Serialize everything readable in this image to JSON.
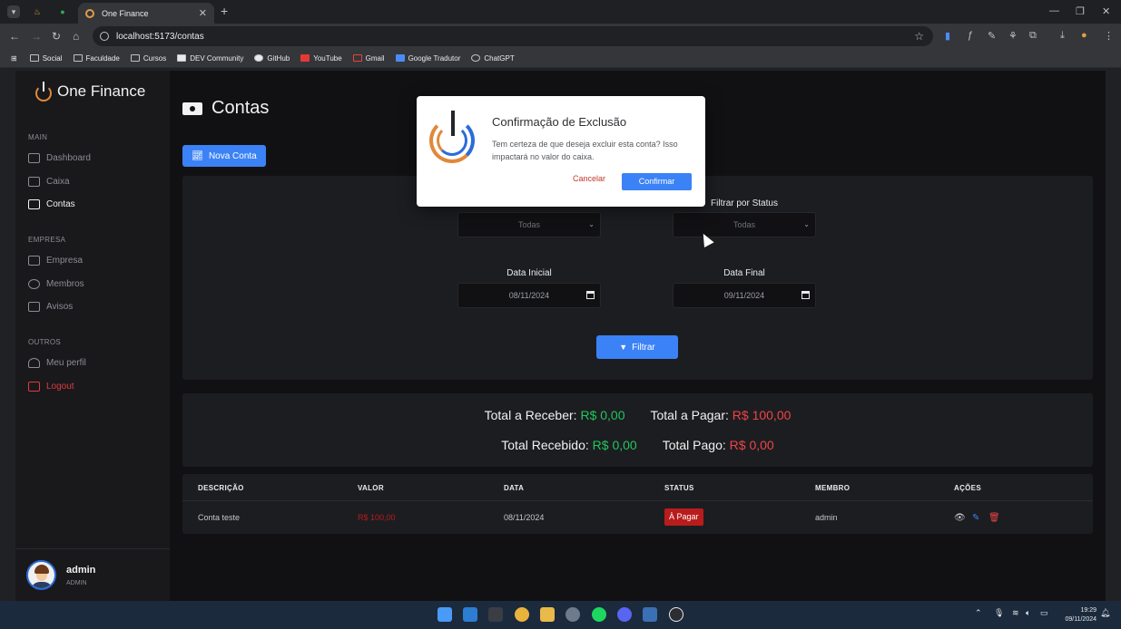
{
  "browser": {
    "tab_title": "One Finance",
    "url": "localhost:5173/contas",
    "bookmarks": [
      "Social",
      "Faculdade",
      "Cursos",
      "DEV Community",
      "GitHub",
      "YouTube",
      "Gmail",
      "Google Tradutor",
      "ChatGPT"
    ]
  },
  "sidebar": {
    "brand": "One Finance",
    "sections": {
      "main": "MAIN",
      "empresa": "EMPRESA",
      "outros": "OUTROS"
    },
    "items": {
      "dashboard": "Dashboard",
      "caixa": "Caixa",
      "contas": "Contas",
      "empresa": "Empresa",
      "membros": "Membros",
      "avisos": "Avisos",
      "perfil": "Meu perfil",
      "logout": "Logout"
    },
    "user": {
      "name": "admin",
      "role": "ADMIN"
    }
  },
  "page": {
    "title": "Contas",
    "new_button": "Nova Conta",
    "filters": {
      "status_label": "Filtrar por Status",
      "type_value": "Todas",
      "status_value": "Todas",
      "start_label": "Data Inicial",
      "end_label": "Data Final",
      "start_value": "08/11/2024",
      "end_value": "09/11/2024",
      "filter_button": "Filtrar"
    },
    "totals": {
      "receber_label": "Total a Receber:",
      "receber_value": "R$ 0,00",
      "pagar_label": "Total a Pagar:",
      "pagar_value": "R$ 100,00",
      "recebido_label": "Total Recebido:",
      "recebido_value": "R$ 0,00",
      "pago_label": "Total Pago:",
      "pago_value": "R$ 0,00"
    },
    "table": {
      "headers": [
        "DESCRIÇÃO",
        "VALOR",
        "DATA",
        "STATUS",
        "MEMBRO",
        "AÇÕES"
      ],
      "rows": [
        {
          "descricao": "Conta teste",
          "valor": "R$ 100,00",
          "data": "08/11/2024",
          "status": "À Pagar",
          "membro": "admin"
        }
      ]
    }
  },
  "modal": {
    "title": "Confirmação de Exclusão",
    "message": "Tem certeza de que deseja excluir esta conta? Isso impactará no valor do caixa.",
    "cancel": "Cancelar",
    "confirm": "Confirmar"
  },
  "taskbar": {
    "time": "19:29",
    "date": "09/11/2024"
  }
}
